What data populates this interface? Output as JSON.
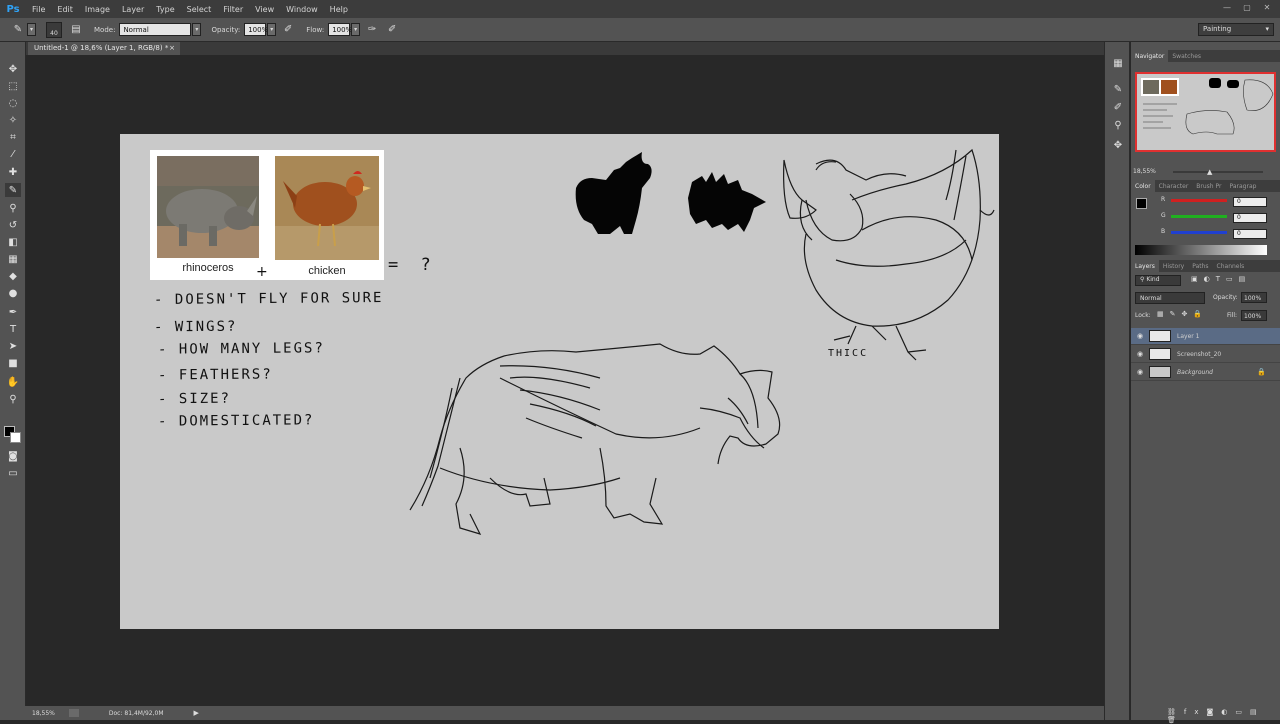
{
  "app": {
    "logo": "Ps"
  },
  "menu": [
    "File",
    "Edit",
    "Image",
    "Layer",
    "Type",
    "Select",
    "Filter",
    "View",
    "Window",
    "Help"
  ],
  "window_controls": {
    "minimize": "—",
    "maximize": "▢",
    "close": "✕"
  },
  "options": {
    "brush_size": "40",
    "mode_label": "Mode:",
    "mode_value": "Normal",
    "opacity_label": "Opacity:",
    "opacity_value": "100%",
    "flow_label": "Flow:",
    "flow_value": "100%",
    "workspace": "Painting"
  },
  "document": {
    "tab_title": "Untitled-1 @ 18,6% (Layer 1, RGB/8) *",
    "tab_close": "×",
    "zoom": "18,55%",
    "doc_info": "Doc: 81,4M/92,0M"
  },
  "canvas": {
    "label_rhino": "rhinoceros",
    "label_chicken": "chicken",
    "plus": "+",
    "equals": "= ?",
    "notes": [
      "- DOESN'T FLY FOR SURE",
      "- WINGS?",
      "- HOW MANY LEGS?",
      "- FEATHERS?",
      "- SIZE?",
      "- DOMESTICATED?"
    ],
    "sketch_label": "THICC"
  },
  "navigator": {
    "tabs": [
      "Navigator",
      "Swatches"
    ],
    "zoom": "18,55%"
  },
  "color": {
    "tabs": [
      "Color",
      "Character",
      "Brush Pr",
      "Paragrap"
    ],
    "r_label": "R",
    "g_label": "G",
    "b_label": "B",
    "r": "0",
    "g": "0",
    "b": "0",
    "red": "#d02020",
    "green": "#20b020",
    "blue": "#2040d0"
  },
  "layers": {
    "tabs": [
      "Layers",
      "History",
      "Paths",
      "Channels"
    ],
    "kind": "Kind",
    "blend": "Normal",
    "opacity_label": "Opacity:",
    "opacity": "100%",
    "lock_label": "Lock:",
    "fill_label": "Fill:",
    "fill": "100%",
    "items": [
      {
        "name": "Layer 1",
        "selected": true
      },
      {
        "name": "Screenshot_20",
        "selected": false
      },
      {
        "name": "Background",
        "selected": false
      }
    ]
  }
}
